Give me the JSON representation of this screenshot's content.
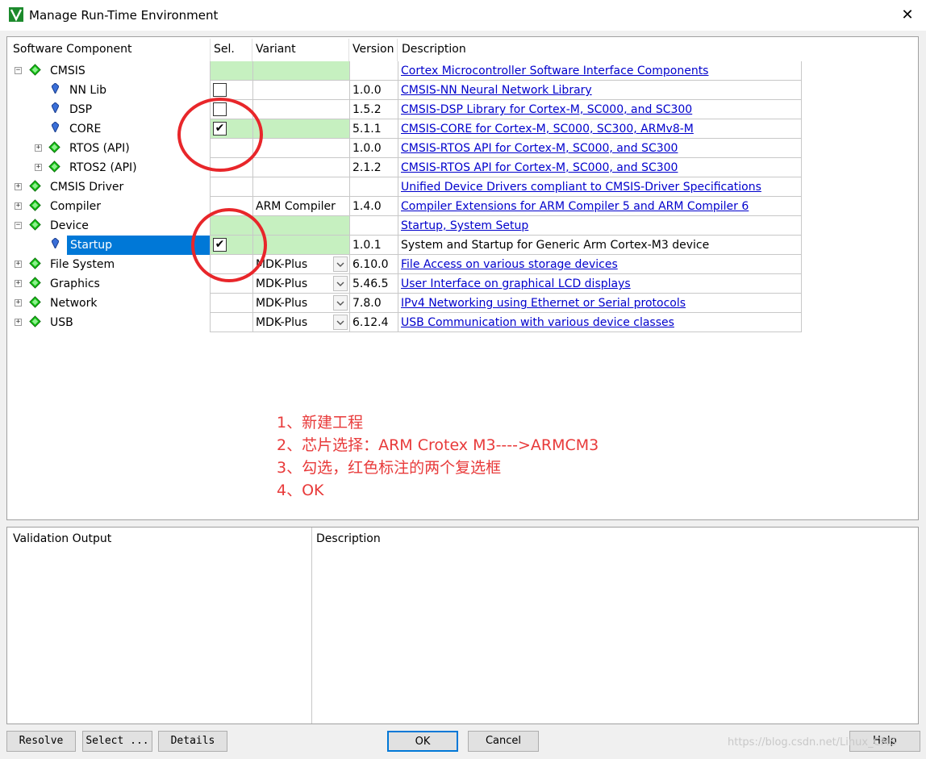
{
  "window": {
    "title": "Manage Run-Time Environment",
    "close_glyph": "✕"
  },
  "columns": {
    "component": "Software Component",
    "sel": "Sel.",
    "variant": "Variant",
    "version": "Version",
    "description": "Description"
  },
  "rows": [
    {
      "name": "CMSIS",
      "variant": "",
      "version": "",
      "description": "Cortex Microcontroller Software Interface Components"
    },
    {
      "name": "NN Lib",
      "variant": "",
      "version": "1.0.0",
      "description": "CMSIS-NN Neural Network Library"
    },
    {
      "name": "DSP",
      "variant": "",
      "version": "1.5.2",
      "description": "CMSIS-DSP Library for Cortex-M, SC000, and SC300"
    },
    {
      "name": "CORE",
      "variant": "",
      "version": "5.1.1",
      "description": "CMSIS-CORE for Cortex-M, SC000, SC300, ARMv8-M"
    },
    {
      "name": "RTOS (API)",
      "variant": "",
      "version": "1.0.0",
      "description": "CMSIS-RTOS API for Cortex-M, SC000, and SC300"
    },
    {
      "name": "RTOS2 (API)",
      "variant": "",
      "version": "2.1.2",
      "description": "CMSIS-RTOS API for Cortex-M, SC000, and SC300"
    },
    {
      "name": "CMSIS Driver",
      "variant": "",
      "version": "",
      "description": "Unified Device Drivers compliant to CMSIS-Driver Specifications"
    },
    {
      "name": "Compiler",
      "variant": "ARM Compiler",
      "version": "1.4.0",
      "description": "Compiler Extensions for ARM Compiler 5 and ARM Compiler 6"
    },
    {
      "name": "Device",
      "variant": "",
      "version": "",
      "description": "Startup, System Setup"
    },
    {
      "name": "Startup",
      "variant": "",
      "version": "1.0.1",
      "description": "System and Startup for Generic Arm Cortex-M3 device"
    },
    {
      "name": "File System",
      "variant": "MDK-Plus",
      "version": "6.10.0",
      "description": "File Access on various storage devices"
    },
    {
      "name": "Graphics",
      "variant": "MDK-Plus",
      "version": "5.46.5",
      "description": "User Interface on graphical LCD displays"
    },
    {
      "name": "Network",
      "variant": "MDK-Plus",
      "version": "7.8.0",
      "description": "IPv4 Networking using Ethernet or Serial protocols"
    },
    {
      "name": "USB",
      "variant": "MDK-Plus",
      "version": "6.12.4",
      "description": "USB Communication with various device classes"
    }
  ],
  "checkmark": "✔",
  "expander": {
    "collapsed": "+",
    "expanded": "−"
  },
  "notes": [
    "1、新建工程",
    "2、芯片选择：ARM Crotex M3---->ARMCM3",
    "3、勾选，红色标注的两个复选框",
    "4、OK"
  ],
  "validation": {
    "output_title": "Validation Output",
    "description_title": "Description"
  },
  "buttons": {
    "resolve": "Resolve",
    "select": "Select ...",
    "details": "Details",
    "ok": "OK",
    "cancel": "Cancel",
    "help": "Help"
  },
  "watermark": "https://blog.csdn.net/Linux_CMS",
  "colors": {
    "selected_row": "#0078d7",
    "green_cell": "#c6f0c0",
    "link": "#0000cc",
    "annotation_red": "#e8262a",
    "gem_green": "#16c216"
  }
}
